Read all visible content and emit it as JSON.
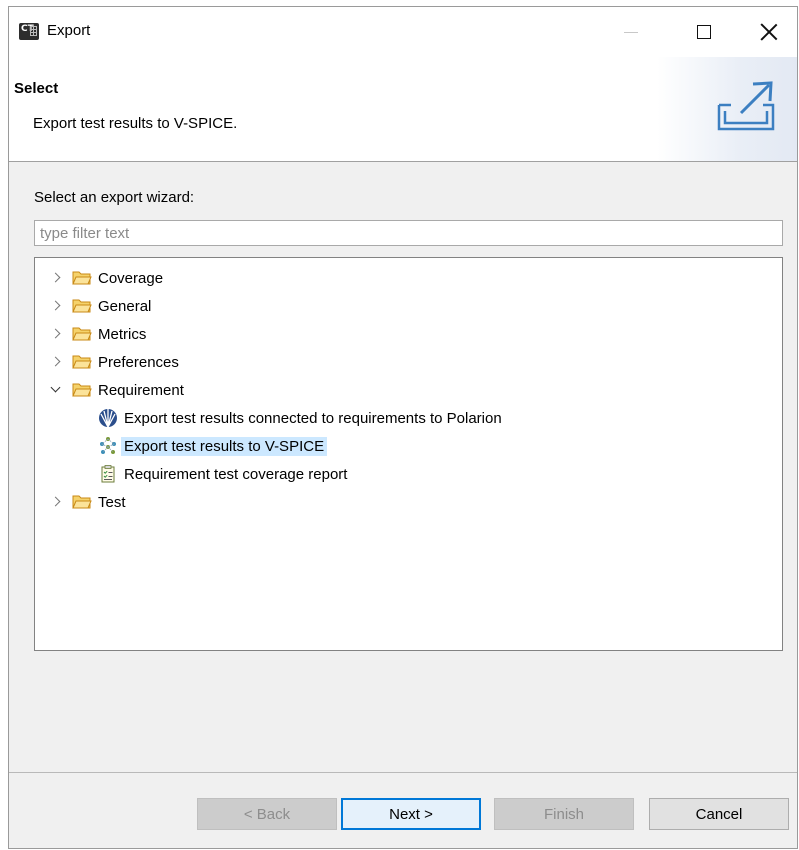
{
  "window": {
    "title": "Export",
    "app_icon_text": "CT"
  },
  "banner": {
    "title": "Select",
    "description": "Export test results to V-SPICE.",
    "icon": "export-arrow-icon"
  },
  "wizard": {
    "label": "Select an export wizard:",
    "filter_placeholder": "type filter text",
    "filter_value": ""
  },
  "tree": {
    "items": [
      {
        "label": "Coverage",
        "expanded": false,
        "icon": "folder-icon"
      },
      {
        "label": "General",
        "expanded": false,
        "icon": "folder-icon"
      },
      {
        "label": "Metrics",
        "expanded": false,
        "icon": "folder-icon"
      },
      {
        "label": "Preferences",
        "expanded": false,
        "icon": "folder-icon"
      },
      {
        "label": "Requirement",
        "expanded": true,
        "icon": "folder-icon",
        "children": [
          {
            "label": "Export test results connected to requirements to Polarion",
            "icon": "polarion-icon"
          },
          {
            "label": "Export test results to V-SPICE",
            "icon": "vspice-icon",
            "selected": true
          },
          {
            "label": "Requirement test coverage report",
            "icon": "report-checklist-icon"
          }
        ]
      },
      {
        "label": "Test",
        "expanded": false,
        "icon": "folder-icon"
      }
    ]
  },
  "buttons": {
    "back": "< Back",
    "next": "Next >",
    "finish": "Finish",
    "cancel": "Cancel"
  },
  "colors": {
    "selection": "#cce8ff",
    "default_button_border": "#0078d7",
    "folder": "#e6a93a"
  }
}
